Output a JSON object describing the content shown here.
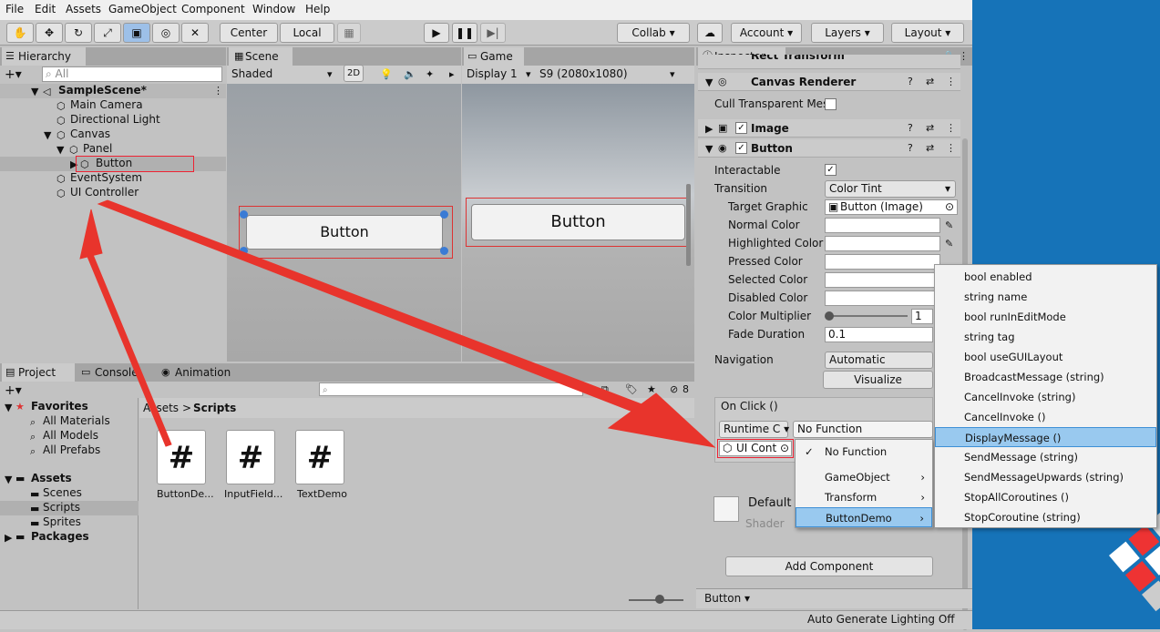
{
  "menubar": {
    "items": [
      "File",
      "Edit",
      "Assets",
      "GameObject",
      "Component",
      "Window",
      "Help"
    ]
  },
  "toolbar": {
    "tools": [
      "hand-tool",
      "move-tool",
      "rotate-tool",
      "scale-tool",
      "rect-tool",
      "transform-tool",
      "custom-tool"
    ],
    "pivot": "Center",
    "space": "Local",
    "collab": "Collab",
    "account": "Account",
    "layers": "Layers",
    "layout": "Layout"
  },
  "hierarchy": {
    "tab": "Hierarchy",
    "search_placeholder": "All",
    "scene": "SampleScene*",
    "items": [
      "Main Camera",
      "Directional Light",
      "Canvas",
      "Panel",
      "Button",
      "EventSystem",
      "UI Controller"
    ]
  },
  "scene": {
    "tab": "Scene",
    "shading": "Shaded",
    "mode_2d": "2D",
    "button_text": "Button"
  },
  "game": {
    "tab": "Game",
    "display": "Display 1",
    "resolution": "S9 (2080x1080)",
    "button_text": "Button"
  },
  "project": {
    "tabs": [
      "Project",
      "Console",
      "Animation"
    ],
    "favorites": "Favorites",
    "fav_items": [
      "All Materials",
      "All Models",
      "All Prefabs"
    ],
    "assets": "Assets",
    "asset_items": [
      "Scenes",
      "Scripts",
      "Sprites"
    ],
    "packages": "Packages",
    "breadcrumb_root": "Assets",
    "breadcrumb_sep": ">",
    "breadcrumb_current": "Scripts",
    "files": [
      "ButtonDe...",
      "InputField...",
      "TextDemo"
    ],
    "file_glyph": "#",
    "hidden_count": "8"
  },
  "inspector": {
    "tab": "Inspector",
    "rect_transform": "Rect Transform",
    "canvas_renderer": "Canvas Renderer",
    "cull_label": "Cull Transparent Mes",
    "image": "Image",
    "button": "Button",
    "interactable": "Interactable",
    "transition_label": "Transition",
    "transition_value": "Color Tint",
    "target_graphic_label": "Target Graphic",
    "target_graphic_value": "Button (Image)",
    "colors": [
      "Normal Color",
      "Highlighted Color",
      "Pressed Color",
      "Selected Color",
      "Disabled Color"
    ],
    "multiplier_label": "Color Multiplier",
    "multiplier_value": "1",
    "fade_label": "Fade Duration",
    "fade_value": "0.1",
    "navigation_label": "Navigation",
    "navigation_value": "Automatic",
    "visualize": "Visualize",
    "onclick": "On Click ()",
    "runtime": "Runtime C",
    "function": "No Function",
    "object": "UI Cont",
    "material_name": "Default",
    "material_shader": "Shader",
    "add_component": "Add Component",
    "footer_obj": "Button"
  },
  "function_menu": {
    "items": [
      "No Function",
      "GameObject",
      "Transform",
      "ButtonDemo"
    ],
    "check": "✓",
    "arrow": "›"
  },
  "method_menu": {
    "items": [
      "bool enabled",
      "string name",
      "bool runInEditMode",
      "string tag",
      "bool useGUILayout",
      "BroadcastMessage (string)",
      "CancelInvoke (string)",
      "CancelInvoke ()",
      "DisplayMessage ()",
      "SendMessage (string)",
      "SendMessageUpwards (string)",
      "StopAllCoroutines ()",
      "StopCoroutine (string)"
    ],
    "highlighted": "DisplayMessage ()"
  },
  "statusbar": {
    "text": "Auto Generate Lighting Off"
  },
  "colors": {
    "accent": "#3d8fd6",
    "annotation": "#e8342c",
    "desktop": "#1673b8"
  }
}
